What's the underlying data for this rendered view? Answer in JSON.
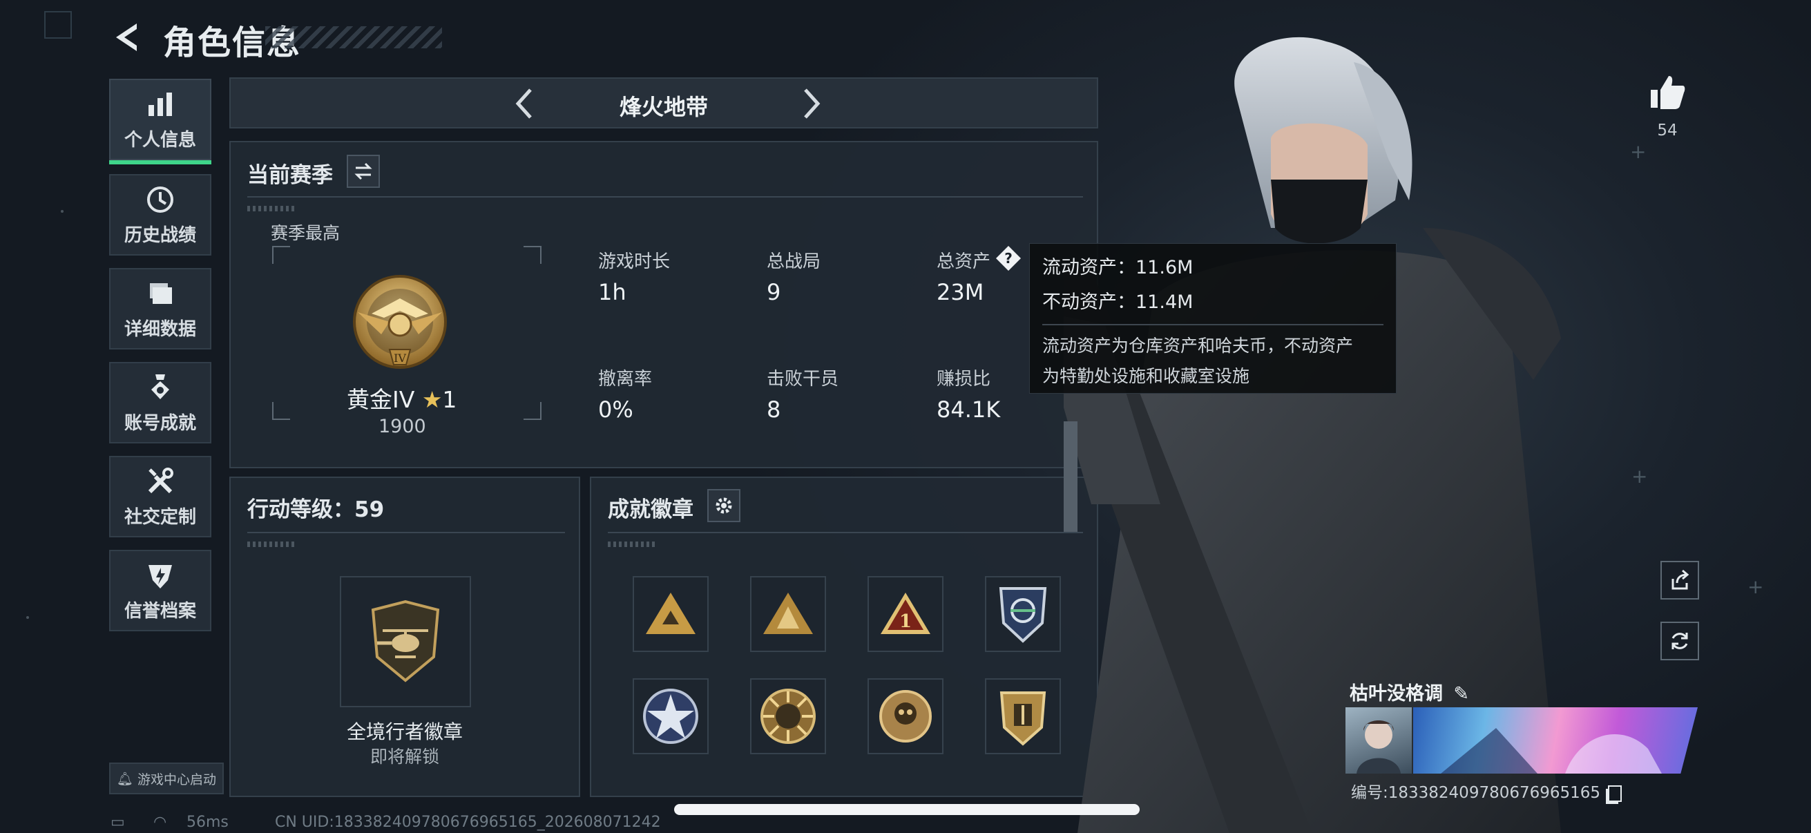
{
  "header": {
    "title": "角色信息"
  },
  "sidebar": {
    "items": [
      {
        "label": "个人信息",
        "icon": "bar-chart-icon",
        "active": true
      },
      {
        "label": "历史战绩",
        "icon": "history-icon"
      },
      {
        "label": "详细数据",
        "icon": "folder-icon"
      },
      {
        "label": "账号成就",
        "icon": "medal-icon"
      },
      {
        "label": "社交定制",
        "icon": "tools-icon"
      },
      {
        "label": "信誉档案",
        "icon": "shield-flash-icon"
      }
    ],
    "game_center": "游戏中心启动"
  },
  "mode": {
    "name": "烽火地带"
  },
  "season": {
    "title": "当前赛季",
    "best_label": "赛季最高",
    "rank": "黄金IV",
    "stars": "1",
    "score": "1900",
    "stats": [
      {
        "label": "游戏时长",
        "value": "1h"
      },
      {
        "label": "总战局",
        "value": "9"
      },
      {
        "label": "总资产",
        "value": "23M"
      },
      {
        "label": "撤离率",
        "value": "0%"
      },
      {
        "label": "击败干员",
        "value": "8"
      },
      {
        "label": "赚损比",
        "value": "84.1K"
      }
    ]
  },
  "tooltip": {
    "liquid": "流动资产：11.6M",
    "fixed": "不动资产：11.4M",
    "desc1": "流动资产为仓库资产和哈夫币，不动资产",
    "desc2": "为特勤处设施和收藏室设施"
  },
  "action_level": {
    "title": "行动等级：59",
    "badge_name": "全境行者徽章",
    "badge_status": "即将解锁"
  },
  "achievements": {
    "title": "成就徽章",
    "count": 8
  },
  "likes": {
    "count": "54"
  },
  "player": {
    "name": "枯叶没格调",
    "id": "编号:18338240978067696516​5"
  },
  "status_bar": {
    "ping": "56ms",
    "uid": "CN UID:18338240978067696516​5_202608071242"
  },
  "colors": {
    "accent": "#3fd58a",
    "background": "#18202a",
    "panel": "#212933"
  }
}
